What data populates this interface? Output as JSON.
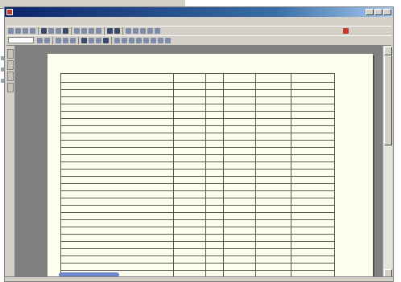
{
  "window": {
    "title": "",
    "minimize_icon": "minimize-icon",
    "maximize_icon": "maximize-icon",
    "close_icon": "close-icon"
  },
  "menu": {
    "items": [
      {
        "label": ""
      },
      {
        "label": ""
      },
      {
        "label": ""
      },
      {
        "label": ""
      },
      {
        "label": ""
      },
      {
        "label": ""
      },
      {
        "label": ""
      },
      {
        "label": ""
      }
    ]
  },
  "toolbar": {
    "zoom": ""
  },
  "colors": {
    "titlebar": "#0a246a",
    "page_background": "#fffff0",
    "accent_red": "#c0392b"
  },
  "document": {
    "header_left": "",
    "title": "",
    "columns": [
      "",
      "",
      "",
      "",
      "",
      ""
    ],
    "rows": [
      {
        "name": "",
        "qty": "",
        "check": "",
        "price": "",
        "amount": "",
        "note": ""
      },
      {
        "name": "",
        "qty": "",
        "check": "",
        "price": "",
        "amount": "",
        "note": ""
      },
      {
        "name": "",
        "qty": "",
        "check": "",
        "price": "",
        "amount": "",
        "note": ""
      },
      {
        "name": "",
        "qty": "",
        "check": "",
        "price": "",
        "amount": "",
        "note": ""
      },
      {
        "name": "",
        "qty": "",
        "check": "",
        "price": "",
        "amount": "",
        "note": ""
      },
      {
        "name": "",
        "qty": "",
        "check": "",
        "price": "",
        "amount": "",
        "note": ""
      },
      {
        "name": "",
        "qty": "",
        "check": "",
        "price": "",
        "amount": "",
        "note": ""
      },
      {
        "name": "",
        "qty": "",
        "check": "",
        "price": "",
        "amount": "",
        "note": ""
      },
      {
        "name": "",
        "qty": "",
        "check": "",
        "price": "",
        "amount": "",
        "note": ""
      },
      {
        "name": "",
        "qty": "",
        "check": "",
        "price": "",
        "amount": "",
        "note": ""
      },
      {
        "name": "",
        "qty": "",
        "check": "",
        "price": "",
        "amount": "",
        "note": ""
      },
      {
        "name": "",
        "qty": "",
        "check": "",
        "price": "",
        "amount": "",
        "note": ""
      },
      {
        "name": "",
        "qty": "",
        "check": "",
        "price": "",
        "amount": "",
        "note": ""
      },
      {
        "name": "",
        "qty": "",
        "check": "",
        "price": "",
        "amount": "",
        "note": ""
      },
      {
        "name": "",
        "qty": "",
        "check": "",
        "price": "",
        "amount": "",
        "note": ""
      },
      {
        "name": "",
        "qty": "",
        "check": "",
        "price": "",
        "amount": "",
        "note": ""
      },
      {
        "name": "",
        "qty": "",
        "check": "",
        "price": "",
        "amount": "",
        "note": ""
      },
      {
        "name": "",
        "qty": "",
        "check": "",
        "price": "",
        "amount": "",
        "note": ""
      },
      {
        "name": "",
        "qty": "",
        "check": "",
        "price": "",
        "amount": "",
        "note": ""
      },
      {
        "name": "",
        "qty": "",
        "check": "",
        "price": "",
        "amount": "",
        "note": ""
      },
      {
        "name": "",
        "qty": "",
        "check": "",
        "price": "",
        "amount": "",
        "note": ""
      },
      {
        "name": "",
        "qty": "",
        "check": "",
        "price": "",
        "amount": "",
        "note": ""
      },
      {
        "name": "",
        "qty": "",
        "check": "",
        "price": "",
        "amount": "",
        "note": ""
      },
      {
        "name": "",
        "qty": "",
        "check": "",
        "price": "",
        "amount": "",
        "note": ""
      },
      {
        "name": "",
        "qty": "",
        "check": "",
        "price": "",
        "amount": "",
        "note": ""
      },
      {
        "name": "",
        "qty": "",
        "check": "",
        "price": "",
        "amount": "",
        "note": ""
      },
      {
        "name": "",
        "qty": "",
        "check": "",
        "price": "",
        "amount": "",
        "note": ""
      }
    ],
    "footer_right": ""
  }
}
